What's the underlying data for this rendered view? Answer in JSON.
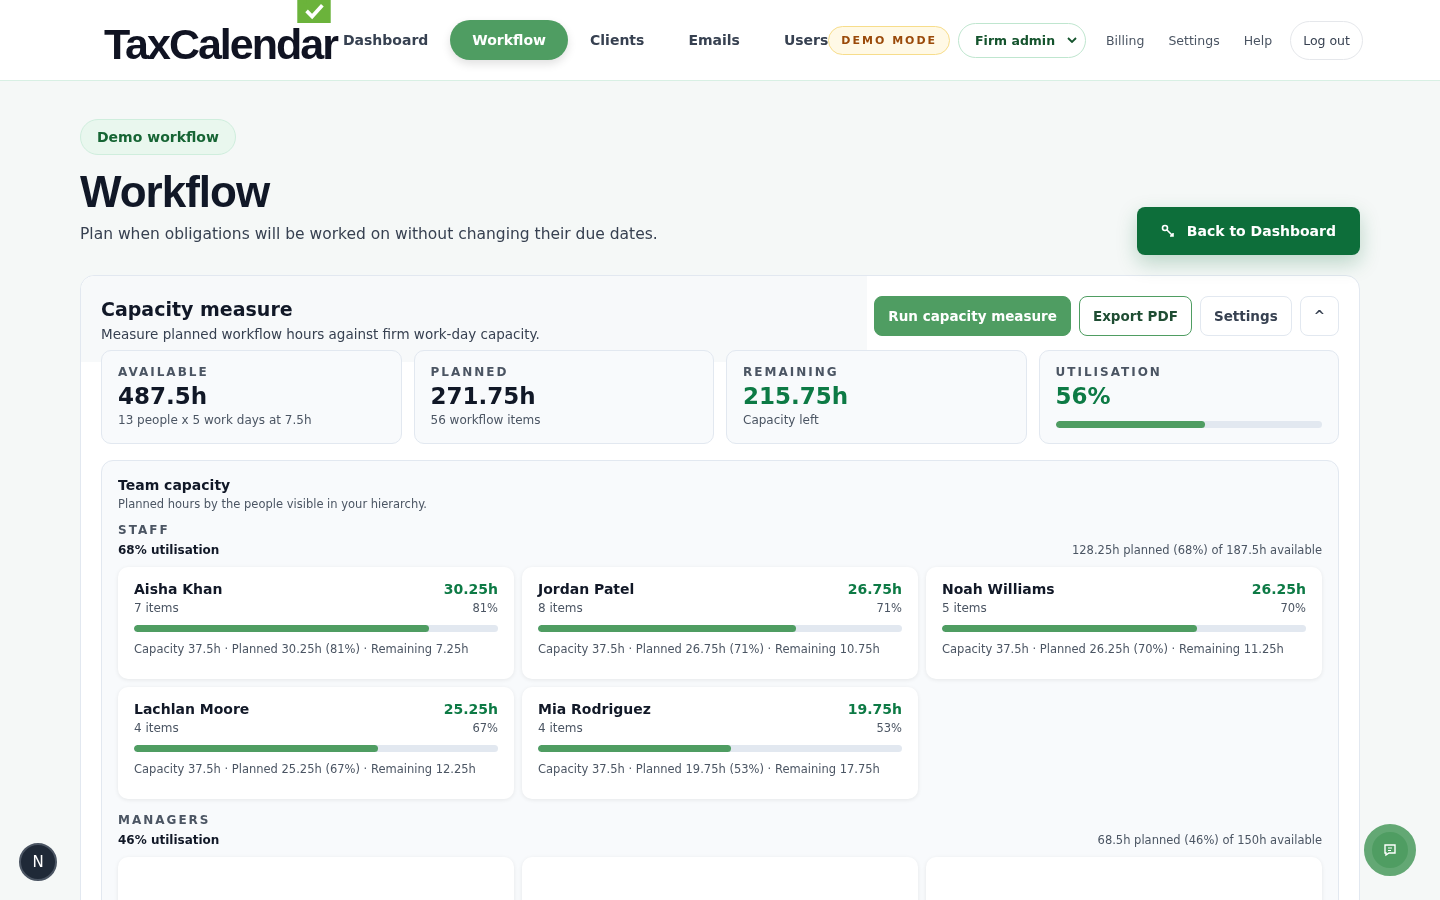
{
  "brand": "TaxCalendar",
  "nav": [
    {
      "label": "Dashboard",
      "selected": false
    },
    {
      "label": "Workflow",
      "selected": true
    },
    {
      "label": "Clients",
      "selected": false
    },
    {
      "label": "Emails",
      "selected": false
    },
    {
      "label": "Users",
      "selected": false
    }
  ],
  "demo_badge": "DEMO MODE",
  "role_select": {
    "value": "Firm admin"
  },
  "nav_links": [
    "Billing",
    "Settings",
    "Help"
  ],
  "logout": "Log out",
  "pill": "Demo workflow",
  "title": "Workflow",
  "subtitle": "Plan when obligations will be worked on without changing their due dates.",
  "back_button": "Back to Dashboard",
  "panel": {
    "title": "Capacity measure",
    "subtitle": "Measure planned workflow hours against firm work-day capacity.",
    "actions": [
      {
        "label": "Run capacity measure",
        "kind": "primary"
      },
      {
        "label": "Export PDF",
        "kind": "outline"
      },
      {
        "label": "Settings",
        "kind": "plain"
      },
      {
        "label": "^",
        "kind": "plain"
      }
    ],
    "stats": [
      {
        "label": "AVAILABLE",
        "value": "487.5h",
        "note": "13 people x 5 work days at 7.5h",
        "accent": false
      },
      {
        "label": "PLANNED",
        "value": "271.75h",
        "note": "56 workflow items",
        "accent": false
      },
      {
        "label": "REMAINING",
        "value": "215.75h",
        "note": "Capacity left",
        "accent": true
      },
      {
        "label": "UTILISATION",
        "value": "56%",
        "level": 0.56,
        "accent": true
      }
    ]
  },
  "team": {
    "title": "Team capacity",
    "subtitle": "Planned hours by the people visible in your hierarchy.",
    "groups": [
      {
        "label": "STAFF",
        "utilisation": "68% utilisation",
        "summary": "128.25h planned (68%) of 187.5h available",
        "people": [
          {
            "name": "Aisha Khan",
            "items": "7 items",
            "hours": "30.25h",
            "pct": "81%",
            "level": 0.81,
            "detail": "Capacity 37.5h · Planned 30.25h (81%) · Remaining 7.25h"
          },
          {
            "name": "Jordan Patel",
            "items": "8 items",
            "hours": "26.75h",
            "pct": "71%",
            "level": 0.71,
            "detail": "Capacity 37.5h · Planned 26.75h (71%) · Remaining 10.75h"
          },
          {
            "name": "Noah Williams",
            "items": "5 items",
            "hours": "26.25h",
            "pct": "70%",
            "level": 0.7,
            "detail": "Capacity 37.5h · Planned 26.25h (70%) · Remaining 11.25h"
          },
          {
            "name": "Lachlan Moore",
            "items": "4 items",
            "hours": "25.25h",
            "pct": "67%",
            "level": 0.67,
            "detail": "Capacity 37.5h · Planned 25.25h (67%) · Remaining 12.25h"
          },
          {
            "name": "Mia Rodriguez",
            "items": "4 items",
            "hours": "19.75h",
            "pct": "53%",
            "level": 0.53,
            "detail": "Capacity 37.5h · Planned 19.75h (53%) · Remaining 17.75h"
          }
        ]
      },
      {
        "label": "MANAGERS",
        "utilisation": "46% utilisation",
        "summary": "68.5h planned (46%) of 150h available",
        "people": [
          {
            "kind": "cut"
          },
          {
            "kind": "cut"
          },
          {
            "kind": "cut"
          }
        ]
      }
    ]
  },
  "corner_badge": "N"
}
